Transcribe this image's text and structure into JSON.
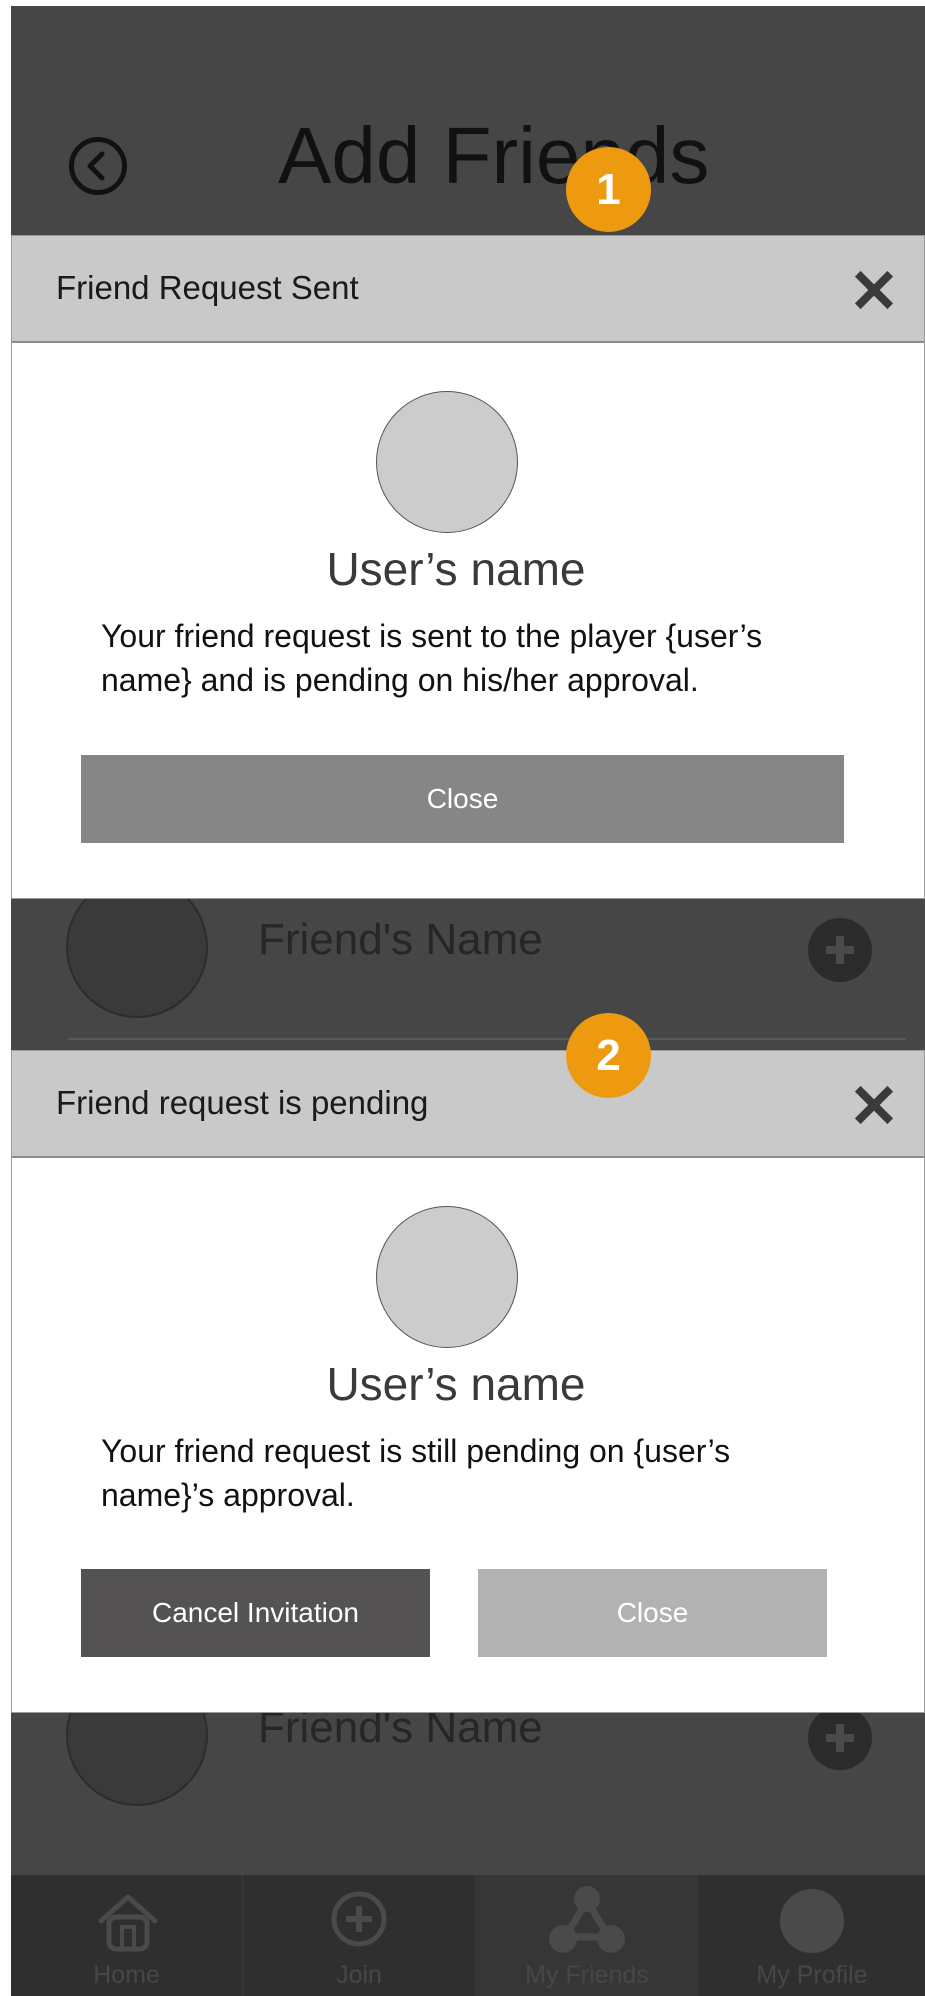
{
  "header": {
    "title": "Add Friends",
    "back_icon": "circle-chevron-left-icon"
  },
  "friend_rows": [
    {
      "name": "Friend's Name",
      "action_icon": "circle-plus-icon"
    },
    {
      "name": "Friend's Name",
      "action_icon": "circle-plus-icon"
    }
  ],
  "dialogs": [
    {
      "step": "1",
      "title": "Friend Request Sent",
      "user_name": "User’s name",
      "message": "Your friend request is sent to the player {user’s name} and is pending on his/her approval.",
      "close_label": "Close"
    },
    {
      "step": "2",
      "title": "Friend request is pending",
      "user_name": "User’s name",
      "message": "Your friend request is still pending on {user’s name}’s approval.",
      "cancel_label": "Cancel Invitation",
      "close_label": "Close"
    }
  ],
  "tab_bar": {
    "tabs": [
      {
        "label": "Home",
        "icon": "home-icon"
      },
      {
        "label": "Join",
        "icon": "circle-plus-icon"
      },
      {
        "label": "My Friends",
        "icon": "network-icon",
        "selected": true
      },
      {
        "label": "My Profile",
        "icon": "avatar-icon"
      }
    ]
  },
  "colors": {
    "overlay": "#464646",
    "dialog_header": "#c9c9c9",
    "step_badge": "#ee9a10",
    "primary_button": "#868686",
    "dark_button": "#555254",
    "light_button": "#b2b2b2",
    "tab_bar": "#2f2f2f"
  }
}
